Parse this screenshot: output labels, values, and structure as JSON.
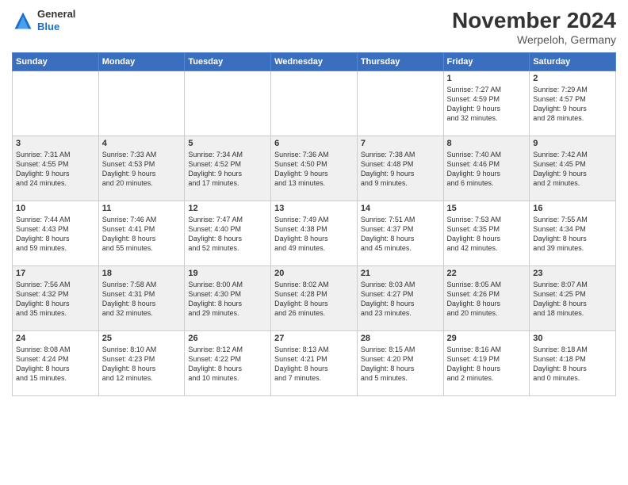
{
  "logo": {
    "general": "General",
    "blue": "Blue"
  },
  "header": {
    "month": "November 2024",
    "location": "Werpeloh, Germany"
  },
  "days_of_week": [
    "Sunday",
    "Monday",
    "Tuesday",
    "Wednesday",
    "Thursday",
    "Friday",
    "Saturday"
  ],
  "weeks": [
    [
      {
        "day": "",
        "info": ""
      },
      {
        "day": "",
        "info": ""
      },
      {
        "day": "",
        "info": ""
      },
      {
        "day": "",
        "info": ""
      },
      {
        "day": "",
        "info": ""
      },
      {
        "day": "1",
        "info": "Sunrise: 7:27 AM\nSunset: 4:59 PM\nDaylight: 9 hours\nand 32 minutes."
      },
      {
        "day": "2",
        "info": "Sunrise: 7:29 AM\nSunset: 4:57 PM\nDaylight: 9 hours\nand 28 minutes."
      }
    ],
    [
      {
        "day": "3",
        "info": "Sunrise: 7:31 AM\nSunset: 4:55 PM\nDaylight: 9 hours\nand 24 minutes."
      },
      {
        "day": "4",
        "info": "Sunrise: 7:33 AM\nSunset: 4:53 PM\nDaylight: 9 hours\nand 20 minutes."
      },
      {
        "day": "5",
        "info": "Sunrise: 7:34 AM\nSunset: 4:52 PM\nDaylight: 9 hours\nand 17 minutes."
      },
      {
        "day": "6",
        "info": "Sunrise: 7:36 AM\nSunset: 4:50 PM\nDaylight: 9 hours\nand 13 minutes."
      },
      {
        "day": "7",
        "info": "Sunrise: 7:38 AM\nSunset: 4:48 PM\nDaylight: 9 hours\nand 9 minutes."
      },
      {
        "day": "8",
        "info": "Sunrise: 7:40 AM\nSunset: 4:46 PM\nDaylight: 9 hours\nand 6 minutes."
      },
      {
        "day": "9",
        "info": "Sunrise: 7:42 AM\nSunset: 4:45 PM\nDaylight: 9 hours\nand 2 minutes."
      }
    ],
    [
      {
        "day": "10",
        "info": "Sunrise: 7:44 AM\nSunset: 4:43 PM\nDaylight: 8 hours\nand 59 minutes."
      },
      {
        "day": "11",
        "info": "Sunrise: 7:46 AM\nSunset: 4:41 PM\nDaylight: 8 hours\nand 55 minutes."
      },
      {
        "day": "12",
        "info": "Sunrise: 7:47 AM\nSunset: 4:40 PM\nDaylight: 8 hours\nand 52 minutes."
      },
      {
        "day": "13",
        "info": "Sunrise: 7:49 AM\nSunset: 4:38 PM\nDaylight: 8 hours\nand 49 minutes."
      },
      {
        "day": "14",
        "info": "Sunrise: 7:51 AM\nSunset: 4:37 PM\nDaylight: 8 hours\nand 45 minutes."
      },
      {
        "day": "15",
        "info": "Sunrise: 7:53 AM\nSunset: 4:35 PM\nDaylight: 8 hours\nand 42 minutes."
      },
      {
        "day": "16",
        "info": "Sunrise: 7:55 AM\nSunset: 4:34 PM\nDaylight: 8 hours\nand 39 minutes."
      }
    ],
    [
      {
        "day": "17",
        "info": "Sunrise: 7:56 AM\nSunset: 4:32 PM\nDaylight: 8 hours\nand 35 minutes."
      },
      {
        "day": "18",
        "info": "Sunrise: 7:58 AM\nSunset: 4:31 PM\nDaylight: 8 hours\nand 32 minutes."
      },
      {
        "day": "19",
        "info": "Sunrise: 8:00 AM\nSunset: 4:30 PM\nDaylight: 8 hours\nand 29 minutes."
      },
      {
        "day": "20",
        "info": "Sunrise: 8:02 AM\nSunset: 4:28 PM\nDaylight: 8 hours\nand 26 minutes."
      },
      {
        "day": "21",
        "info": "Sunrise: 8:03 AM\nSunset: 4:27 PM\nDaylight: 8 hours\nand 23 minutes."
      },
      {
        "day": "22",
        "info": "Sunrise: 8:05 AM\nSunset: 4:26 PM\nDaylight: 8 hours\nand 20 minutes."
      },
      {
        "day": "23",
        "info": "Sunrise: 8:07 AM\nSunset: 4:25 PM\nDaylight: 8 hours\nand 18 minutes."
      }
    ],
    [
      {
        "day": "24",
        "info": "Sunrise: 8:08 AM\nSunset: 4:24 PM\nDaylight: 8 hours\nand 15 minutes."
      },
      {
        "day": "25",
        "info": "Sunrise: 8:10 AM\nSunset: 4:23 PM\nDaylight: 8 hours\nand 12 minutes."
      },
      {
        "day": "26",
        "info": "Sunrise: 8:12 AM\nSunset: 4:22 PM\nDaylight: 8 hours\nand 10 minutes."
      },
      {
        "day": "27",
        "info": "Sunrise: 8:13 AM\nSunset: 4:21 PM\nDaylight: 8 hours\nand 7 minutes."
      },
      {
        "day": "28",
        "info": "Sunrise: 8:15 AM\nSunset: 4:20 PM\nDaylight: 8 hours\nand 5 minutes."
      },
      {
        "day": "29",
        "info": "Sunrise: 8:16 AM\nSunset: 4:19 PM\nDaylight: 8 hours\nand 2 minutes."
      },
      {
        "day": "30",
        "info": "Sunrise: 8:18 AM\nSunset: 4:18 PM\nDaylight: 8 hours\nand 0 minutes."
      }
    ]
  ]
}
